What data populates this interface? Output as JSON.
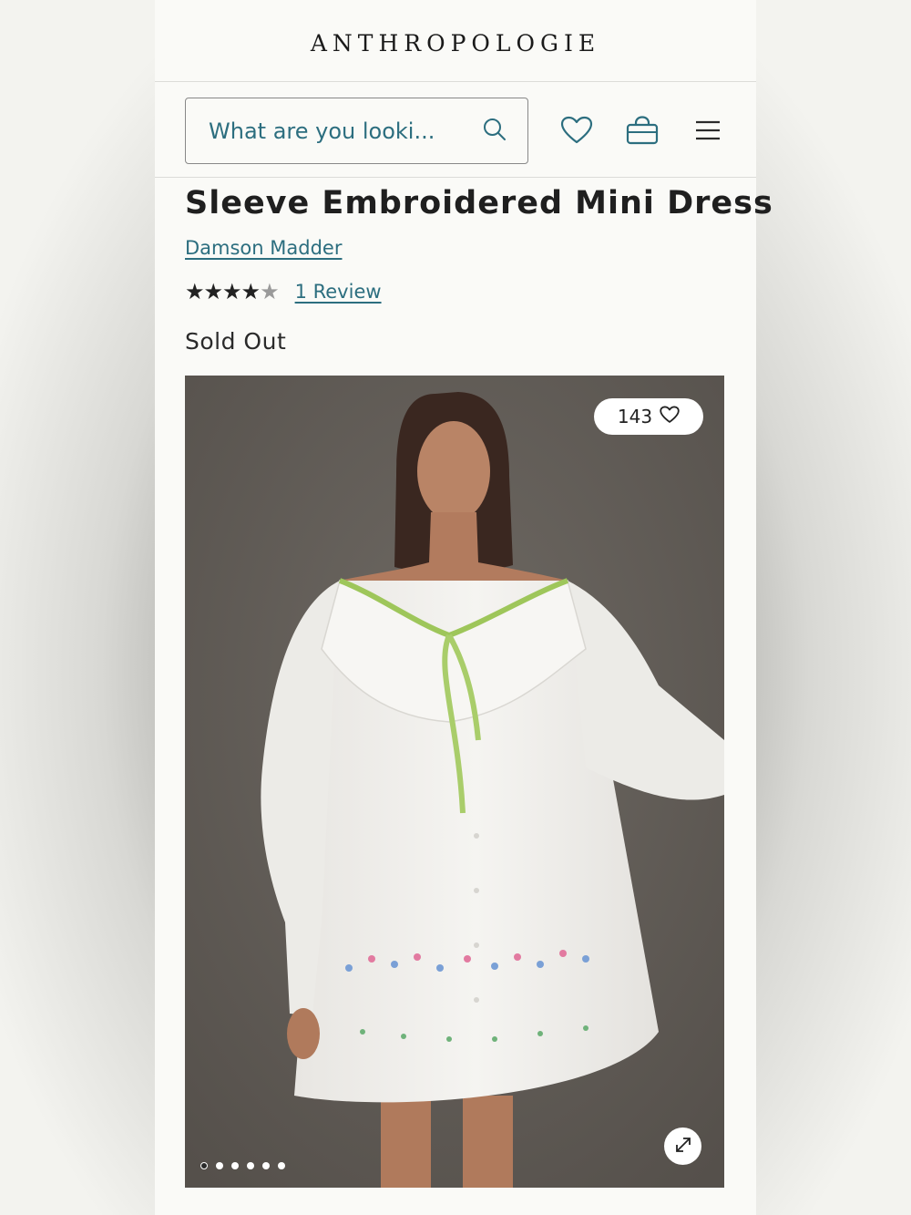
{
  "brand": {
    "name": "ANTHROPOLOGIE"
  },
  "search": {
    "placeholder": "What are you looki..."
  },
  "header": {
    "icons": [
      "search-icon",
      "heart-icon",
      "shopping-bag-icon",
      "menu-icon"
    ]
  },
  "product": {
    "title": "Sleeve Embroidered Mini Dress",
    "brand": "Damson Madder",
    "rating": 4.5,
    "rating_max": 5,
    "review_link": "1 Review",
    "stock_status": "Sold Out"
  },
  "gallery": {
    "favorites_count": "143",
    "image_count": 6,
    "active_index": 0
  },
  "colors": {
    "link": "#2c6e7f",
    "text": "#1f1f1f",
    "page_bg": "#fafaf7"
  }
}
